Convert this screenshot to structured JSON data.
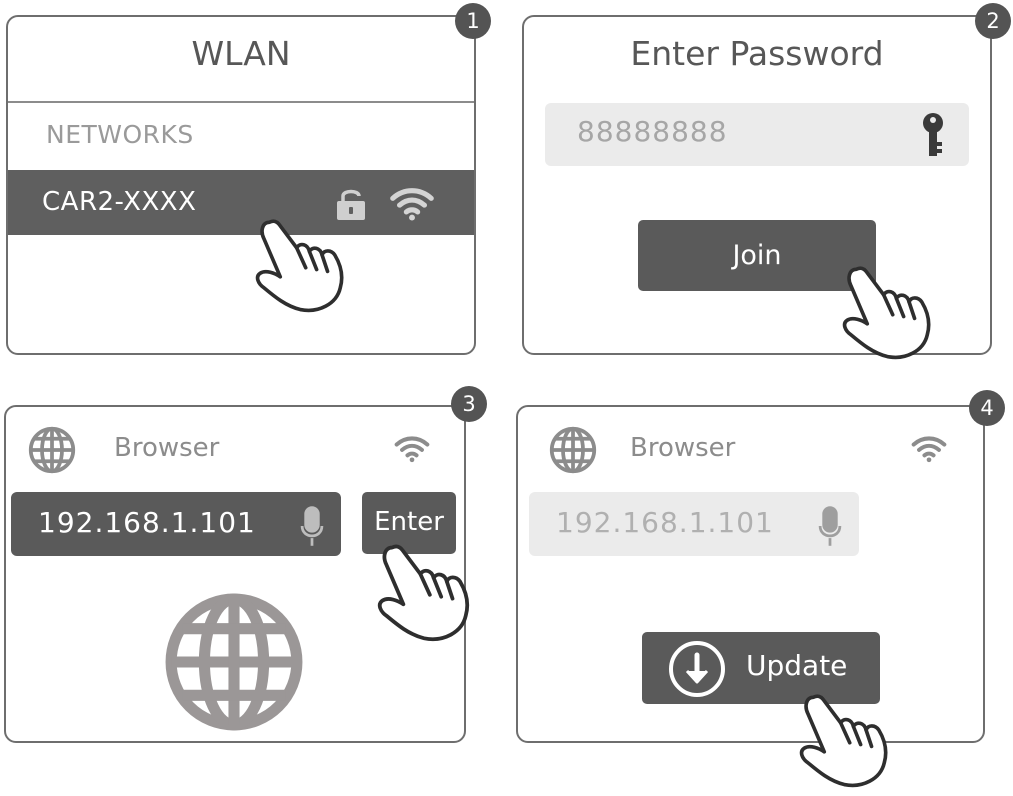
{
  "steps": [
    {
      "number": "1",
      "title": "WLAN",
      "section_label": "NETWORKS",
      "network_name": "CAR2-XXXX",
      "icons": [
        "lock-icon",
        "wifi-icon"
      ]
    },
    {
      "number": "2",
      "title": "Enter Password",
      "password_value": "88888888",
      "join_label": "Join",
      "icons": [
        "key-icon"
      ]
    },
    {
      "number": "3",
      "browser_label": "Browser",
      "url_value": "192.168.1.101",
      "enter_label": "Enter",
      "icons": [
        "globe-icon",
        "wifi-icon",
        "microphone-icon",
        "globe-large-icon"
      ]
    },
    {
      "number": "4",
      "browser_label": "Browser",
      "url_value": "192.168.1.101",
      "update_label": "Update",
      "icons": [
        "globe-icon",
        "wifi-icon",
        "microphone-icon",
        "download-icon"
      ]
    }
  ],
  "colors": {
    "dark_fill": "#5a5a5a",
    "light_fill": "#ebebeb",
    "outline": "#6e6e6e",
    "muted_text": "#9a9a9a"
  }
}
